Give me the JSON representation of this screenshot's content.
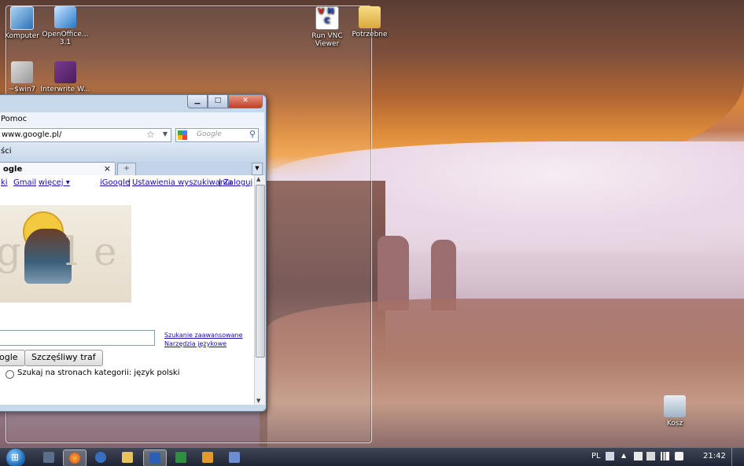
{
  "desktop": {
    "icons": [
      {
        "label": "Komputer"
      },
      {
        "label": "OpenOffice... 3.1"
      },
      {
        "label": "Run VNC Viewer"
      },
      {
        "label": "Potrzebne"
      },
      {
        "label": "~$win7"
      },
      {
        "label": "Interwrite W..."
      },
      {
        "label": "Kosz"
      }
    ]
  },
  "browser": {
    "menu_fragment": "Pomoc",
    "url": "www.google.pl/",
    "search_placeholder": "Google",
    "bookmarks_fragment": "ści",
    "tab_title": "ogle",
    "tab_close": "×",
    "newtab": "+",
    "links_left": [
      "ki",
      "Gmail",
      "więcej ▾"
    ],
    "links_right": [
      "iGoogle",
      "Ustawienia wyszukiwania",
      "Zaloguj"
    ],
    "adv_search": "Szukanie zaawansowane",
    "lang_tools": "Narzędzia językowe",
    "btn_search": "ogle",
    "btn_lucky": "Szczęśliwy traf",
    "radio_label": "Szukaj na stronach kategorii: język polski",
    "doodle_letters": [
      "g",
      "l",
      "e"
    ]
  },
  "taskbar": {
    "lang": "PL",
    "clock": "21:42",
    "items": [
      "windows-media-player",
      "firefox",
      "network",
      "explorer",
      "word",
      "excel",
      "media",
      "setup"
    ]
  },
  "colors": {
    "link": "#1a0dab",
    "accent": "#3461a8"
  }
}
